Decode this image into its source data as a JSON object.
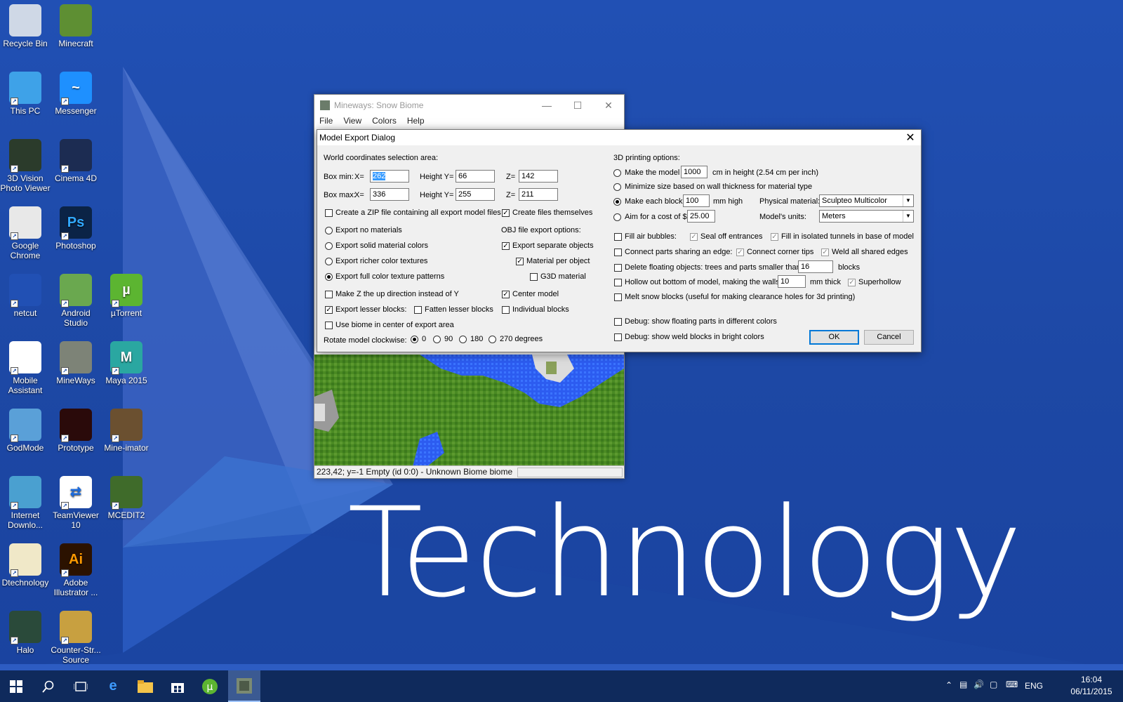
{
  "desktop": {
    "wallpaper_text": "Technology",
    "icons": [
      {
        "label": "Recycle Bin",
        "icon": "recycle-bin-icon"
      },
      {
        "label": "Minecraft",
        "icon": "minecraft-grass-block-icon"
      },
      {
        "label": "This PC",
        "icon": "computer-icon"
      },
      {
        "label": "Messenger",
        "icon": "messenger-icon"
      },
      {
        "label": "3D Vision Photo Viewer",
        "icon": "3d-vision-icon"
      },
      {
        "label": "Cinema 4D",
        "icon": "cinema4d-icon"
      },
      {
        "label": "Google Chrome",
        "icon": "chrome-icon"
      },
      {
        "label": "Photoshop",
        "icon": "photoshop-icon"
      },
      {
        "label": "netcut",
        "icon": "scissors-icon"
      },
      {
        "label": "Android Studio",
        "icon": "android-studio-icon"
      },
      {
        "label": "µTorrent",
        "icon": "utorrent-icon"
      },
      {
        "label": "Mobile Assistant",
        "icon": "mobile-assistant-icon"
      },
      {
        "label": "MineWays",
        "icon": "mineways-icon"
      },
      {
        "label": "Maya 2015",
        "icon": "maya-icon"
      },
      {
        "label": "GodMode",
        "icon": "godmode-icon"
      },
      {
        "label": "Prototype",
        "icon": "prototype-icon"
      },
      {
        "label": "Mine-imator",
        "icon": "mine-imator-icon"
      },
      {
        "label": "Internet Downlo...",
        "icon": "idm-icon"
      },
      {
        "label": "TeamViewer 10",
        "icon": "teamviewer-icon"
      },
      {
        "label": "MCEDIT2",
        "icon": "mcedit-icon"
      },
      {
        "label": "Dtechnology",
        "icon": "dtechnology-icon"
      },
      {
        "label": "Adobe Illustrator ...",
        "icon": "illustrator-icon"
      },
      {
        "label": "Halo",
        "icon": "halo-icon"
      },
      {
        "label": "Counter-Str... Source",
        "icon": "counter-strike-icon"
      }
    ]
  },
  "mineways": {
    "title": "Mineways: Snow Biome",
    "menu": [
      "File",
      "View",
      "Colors",
      "Help"
    ],
    "status": "223,42; y=-1 Empty (id 0:0) - Unknown Biome biome"
  },
  "dialog": {
    "title": "Model Export Dialog",
    "world_coords_label": "World coordinates selection area:",
    "box_min_label": "Box min:",
    "box_max_label": "Box max:",
    "x_label": "X=",
    "height_y_label": "Height Y=",
    "z_label": "Z=",
    "box_min": {
      "x": "262",
      "y": "66",
      "z": "142"
    },
    "box_max": {
      "x": "336",
      "y": "255",
      "z": "211"
    },
    "create_zip": "Create a ZIP file containing all export model files",
    "create_files": "Create files themselves",
    "export_no_materials": "Export no materials",
    "export_solid": "Export solid material colors",
    "export_richer": "Export richer color textures",
    "export_full": "Export full color texture patterns",
    "obj_options": "OBJ file export options:",
    "export_separate": "Export separate objects",
    "material_per_object": "Material per object",
    "g3d_material": "G3D material",
    "make_z_up": "Make Z the up direction instead of Y",
    "center_model": "Center model",
    "export_lesser": "Export lesser blocks:",
    "fatten_lesser": "Fatten lesser blocks",
    "individual_blocks": "Individual blocks",
    "use_biome": "Use biome in center of export area",
    "rotate_label": "Rotate model clockwise:",
    "rotate_options": [
      "0",
      "90",
      "180",
      "270 degrees"
    ],
    "printing_label": "3D printing options:",
    "make_model": "Make the model",
    "make_model_value": "1000",
    "make_model_suffix": "cm in height (2.54 cm per inch)",
    "minimize_size": "Minimize size based on wall thickness for material type",
    "make_each_block": "Make each block",
    "each_block_value": "100",
    "each_block_suffix": "mm high",
    "physical_material_label": "Physical material:",
    "physical_material": "Sculpteo Multicolor",
    "aim_cost": "Aim for a cost of $",
    "aim_cost_value": "25.00",
    "units_label": "Model's units:",
    "units": "Meters",
    "fill_air": "Fill air bubbles:",
    "seal_off": "Seal off entrances",
    "fill_isolated": "Fill in isolated tunnels in base of model",
    "connect_parts": "Connect parts sharing an edge:",
    "connect_corner": "Connect corner tips",
    "weld_all": "Weld all shared edges",
    "delete_floating": "Delete floating objects: trees and parts smaller than",
    "delete_floating_value": "16",
    "delete_floating_suffix": "blocks",
    "hollow_out": "Hollow out bottom of model, making the walls",
    "hollow_value": "10",
    "hollow_suffix": "mm thick",
    "superhollow": "Superhollow",
    "melt_snow": "Melt snow blocks (useful for making clearance holes for 3d printing)",
    "debug_floating": "Debug: show floating parts in different colors",
    "debug_weld": "Debug: show weld blocks in bright colors",
    "ok": "OK",
    "cancel": "Cancel"
  },
  "taskbar": {
    "language": "ENG",
    "time": "16:04",
    "date": "06/11/2015"
  }
}
